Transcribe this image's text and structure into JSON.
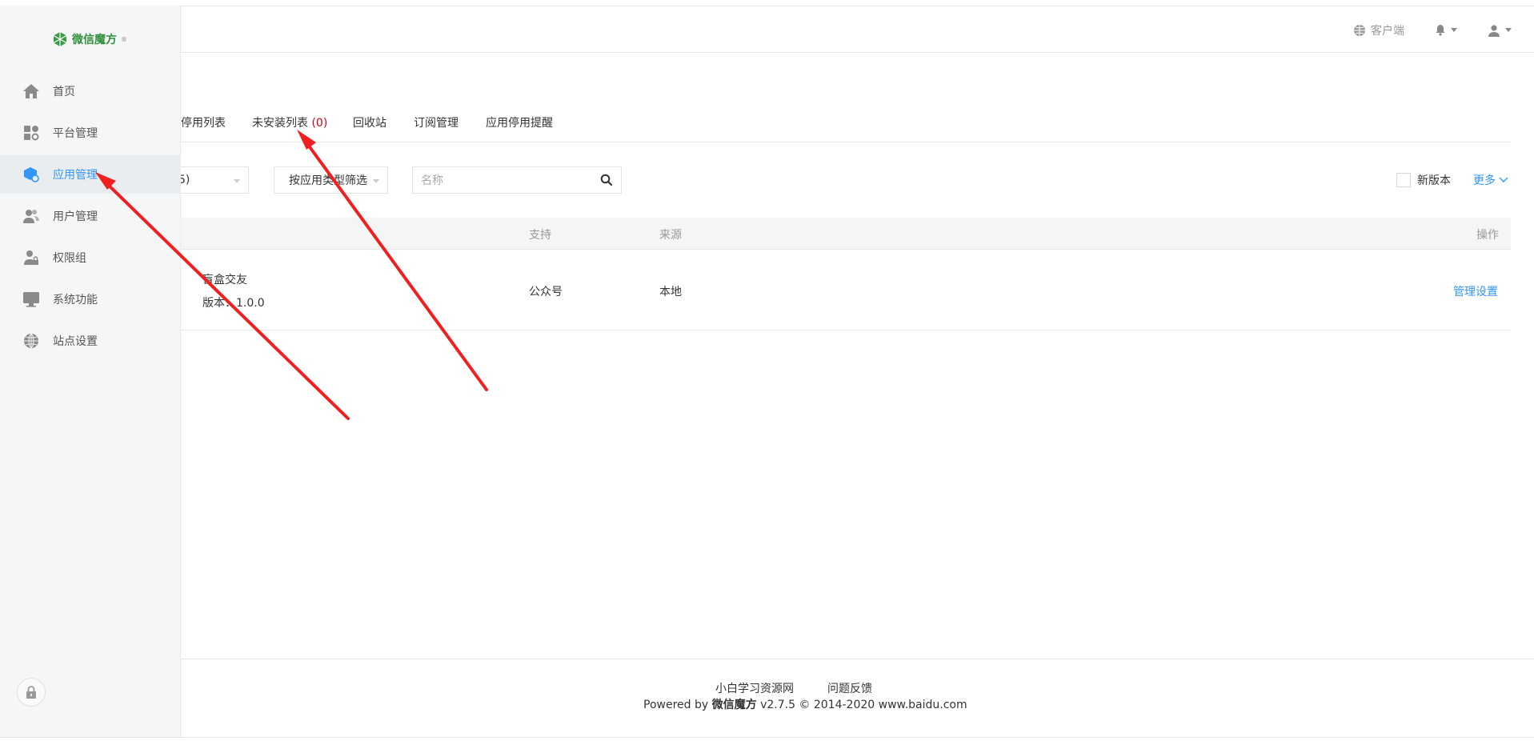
{
  "header": {
    "client_label": "客户端"
  },
  "logo": {
    "text": "微信魔方"
  },
  "sidebar": {
    "items": [
      {
        "label": "首页",
        "icon": "home-icon"
      },
      {
        "label": "平台管理",
        "icon": "platform-icon"
      },
      {
        "label": "应用管理",
        "icon": "app-icon",
        "active": true
      },
      {
        "label": "用户管理",
        "icon": "users-icon"
      },
      {
        "label": "权限组",
        "icon": "user-lock-icon"
      },
      {
        "label": "系统功能",
        "icon": "monitor-icon"
      },
      {
        "label": "站点设置",
        "icon": "globe-icon"
      }
    ]
  },
  "tabs": [
    {
      "label": "停用列表"
    },
    {
      "label": "未安装列表",
      "count": "(0)"
    },
    {
      "label": "回收站"
    },
    {
      "label": "订阅管理"
    },
    {
      "label": "应用停用提醒"
    }
  ],
  "filters": {
    "first_select_partial": "5)",
    "type_select": "按应用类型筛选",
    "search_placeholder": "名称",
    "new_version_label": "新版本",
    "more_label": "更多"
  },
  "table": {
    "headers": {
      "support": "支持",
      "source": "来源",
      "action": "操作"
    },
    "rows": [
      {
        "name": "盲盒交友",
        "version": "版本：1.0.0",
        "support": "公众号",
        "source": "本地",
        "action": "管理设置"
      }
    ]
  },
  "footer": {
    "links": [
      "小白学习资源网",
      "问题反馈"
    ],
    "powered_prefix": "Powered by",
    "brand": "微信魔方",
    "powered_suffix": "v2.7.5 © 2014-2020 www.baidu.com"
  },
  "colors": {
    "accent": "#3296fa",
    "count_red": "#d0021b",
    "logo_green": "#2f8f3a",
    "arrow_red": "#f02020"
  }
}
